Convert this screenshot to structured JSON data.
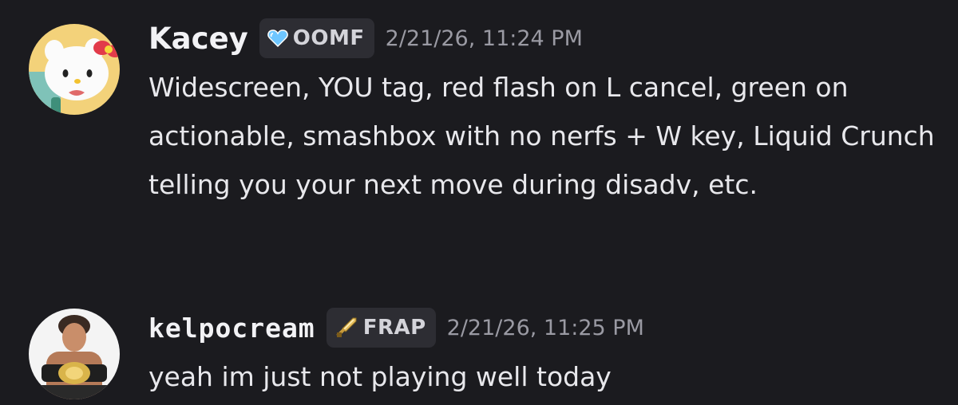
{
  "messages": [
    {
      "username": "Kacey",
      "tag": {
        "icon": "heart-icon",
        "label": "OOMF",
        "color": "#6ec6ff"
      },
      "timestamp": "2/21/26, 11:24 PM",
      "text": "Widescreen, YOU tag, red flash on L cancel, green on actionable, smashbox with no nerfs + W key, Liquid Crunch telling you your next move during disadv, etc."
    },
    {
      "username": "kelpocream",
      "tag": {
        "icon": "sword-icon",
        "label": "FRAP",
        "color": "#e8c060"
      },
      "timestamp": "2/21/26, 11:25 PM",
      "text": "yeah im just not playing well today"
    }
  ]
}
